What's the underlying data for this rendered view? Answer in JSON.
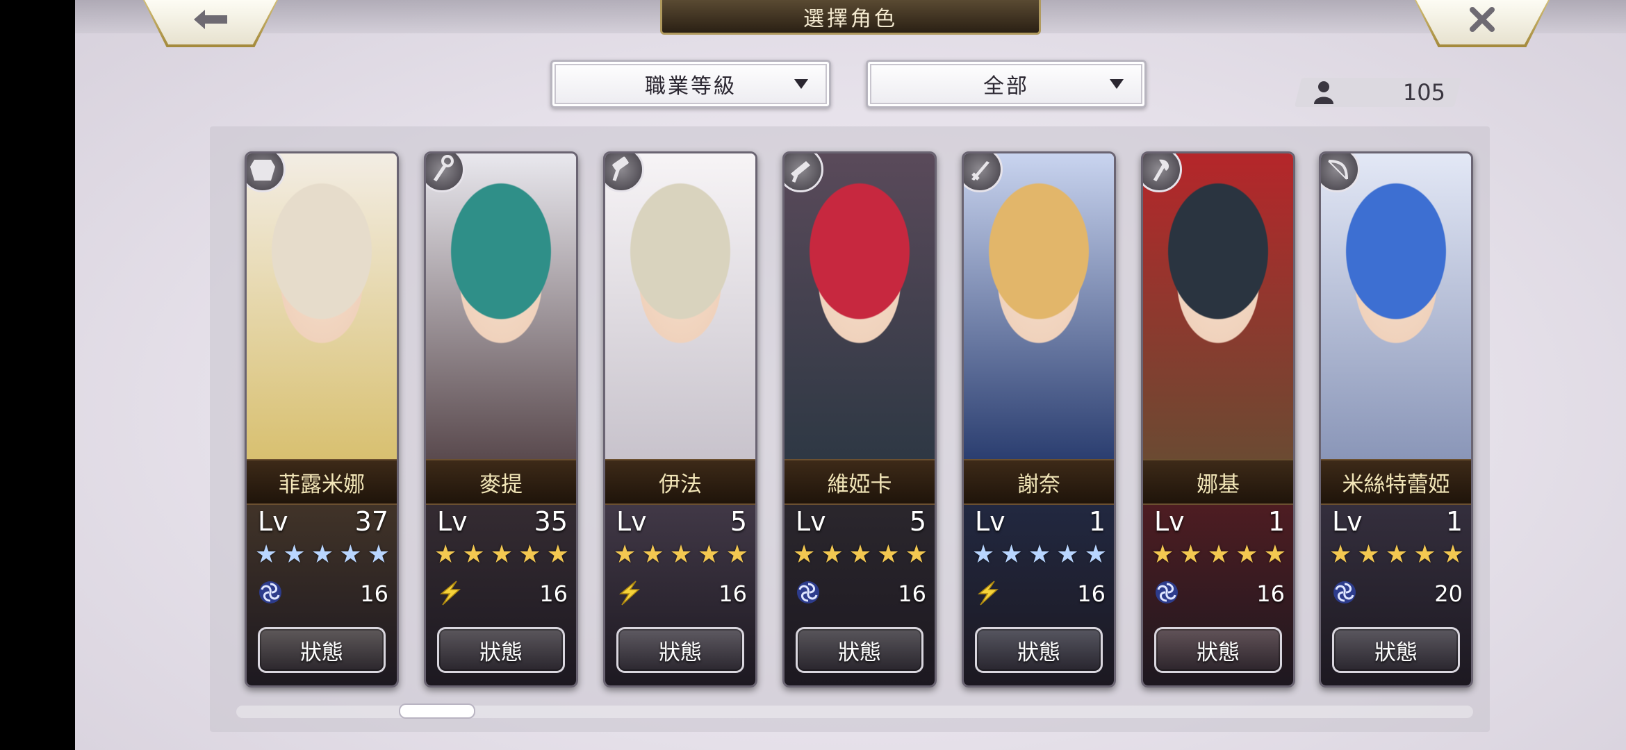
{
  "header": {
    "title": "選擇角色"
  },
  "filters": {
    "sort_label": "職業等級",
    "scope_label": "全部"
  },
  "unit_count": "105",
  "colors": {
    "star_blue": "#b9d6ff",
    "star_gold": "#f3c851",
    "accent_gold": "#c9a95a"
  },
  "characters": [
    {
      "name": "菲露米娜",
      "lv_label": "Lv",
      "level": "37",
      "star_color": "blue",
      "element": "wind-swirl",
      "element_value": "16",
      "status_label": "狀態",
      "class_icon": "armor-icon",
      "hair": "#e6dccb",
      "bg_top": "#f3ede4",
      "bg_bottom": "#d8c070",
      "lower_bg": "#4a3a2a"
    },
    {
      "name": "麥提",
      "lv_label": "Lv",
      "level": "35",
      "star_color": "gold",
      "element": "lightning",
      "element_value": "16",
      "status_label": "狀態",
      "class_icon": "staff-icon",
      "hair": "#2f8f88",
      "bg_top": "#e9e8ee",
      "bg_bottom": "#5a4a4e",
      "lower_bg": "#3a3036"
    },
    {
      "name": "伊法",
      "lv_label": "Lv",
      "level": "5",
      "star_color": "gold",
      "element": "lightning",
      "element_value": "16",
      "status_label": "狀態",
      "class_icon": "hammer-icon",
      "hair": "#d9d3be",
      "bg_top": "#f7f4f6",
      "bg_bottom": "#c8c3cc",
      "lower_bg": "#4a4050"
    },
    {
      "name": "維婭卡",
      "lv_label": "Lv",
      "level": "5",
      "star_color": "gold",
      "element": "wind-swirl",
      "element_value": "16",
      "status_label": "狀態",
      "class_icon": "gun-icon",
      "hair": "#c7283f",
      "bg_top": "#5a4a5a",
      "bg_bottom": "#2e3844",
      "lower_bg": "#2e2a30"
    },
    {
      "name": "謝奈",
      "lv_label": "Lv",
      "level": "1",
      "star_color": "blue",
      "element": "lightning",
      "element_value": "16",
      "status_label": "狀態",
      "class_icon": "sword-icon",
      "hair": "#e2b66a",
      "bg_top": "#c9d4ef",
      "bg_bottom": "#2b3e70",
      "lower_bg": "#232c48"
    },
    {
      "name": "娜基",
      "lv_label": "Lv",
      "level": "1",
      "star_color": "gold",
      "element": "wind-swirl",
      "element_value": "16",
      "status_label": "狀態",
      "class_icon": "axe-icon",
      "hair": "#2a3440",
      "bg_top": "#b5262a",
      "bg_bottom": "#6b4a32",
      "lower_bg": "#5a1e22"
    },
    {
      "name": "米絲特蕾婭",
      "lv_label": "Lv",
      "level": "1",
      "star_color": "gold",
      "element": "wind-swirl",
      "element_value": "20",
      "status_label": "狀態",
      "class_icon": "bow-icon",
      "hair": "#3d6fd2",
      "bg_top": "#e3e8f6",
      "bg_bottom": "#8a96b8",
      "lower_bg": "#3a3444"
    }
  ]
}
